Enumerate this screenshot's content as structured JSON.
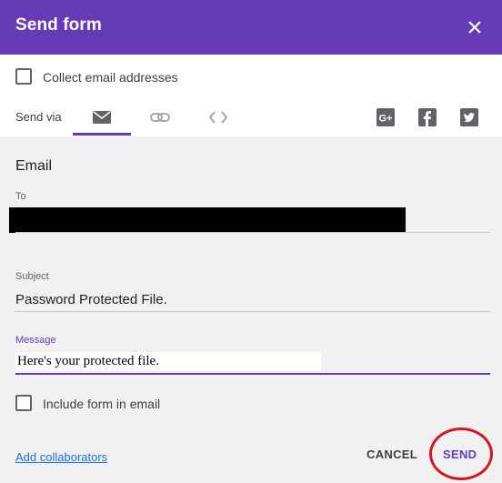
{
  "dialog": {
    "title": "Send form",
    "close_icon": "close-icon"
  },
  "options": {
    "collect_email_label": "Collect email addresses",
    "collect_email_checked": false
  },
  "send_via": {
    "label": "Send via",
    "tabs": [
      {
        "name": "email",
        "icon": "email-icon",
        "active": true
      },
      {
        "name": "link",
        "icon": "link-icon",
        "active": false
      },
      {
        "name": "embed",
        "icon": "embed-code-icon",
        "active": false
      }
    ],
    "social": [
      "google-plus-icon",
      "facebook-icon",
      "twitter-icon"
    ],
    "accent_color": "#673ab7"
  },
  "email": {
    "section_title": "Email",
    "to_label": "To",
    "to_value_redacted": true,
    "subject_label": "Subject",
    "subject_value": "Password Protected File.",
    "message_label": "Message",
    "message_value": "Here's your protected file.",
    "include_form_label": "Include form in email",
    "include_form_checked": false
  },
  "footer": {
    "add_collaborators": "Add collaborators",
    "cancel": "CANCEL",
    "send": "SEND"
  }
}
